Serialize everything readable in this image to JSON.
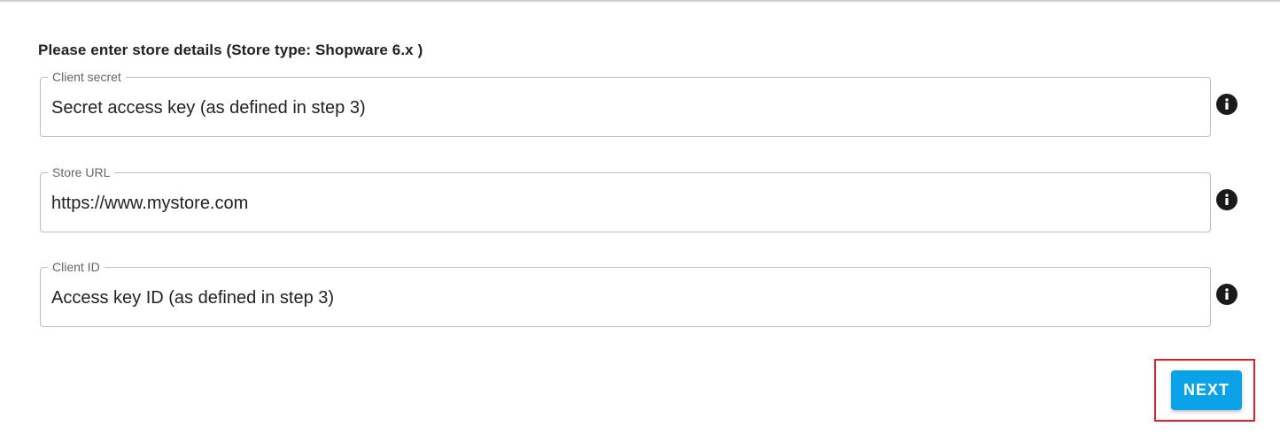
{
  "form": {
    "heading": "Please enter store details (Store type: Shopware 6.x )",
    "fields": [
      {
        "label": "Client secret",
        "placeholder": "Secret access key (as defined in step 3)",
        "value": ""
      },
      {
        "label": "Store URL",
        "placeholder": "https://www.mystore.com",
        "value": ""
      },
      {
        "label": "Client ID",
        "placeholder": "Access key ID (as defined in step 3)",
        "value": ""
      }
    ],
    "info_icon": "info-circle-icon"
  },
  "actions": {
    "next_label": "NEXT"
  },
  "colors": {
    "accent": "#0ba2e8",
    "highlight_border": "#e0212b",
    "field_border": "#bdbdbd",
    "label_text": "#666666"
  }
}
